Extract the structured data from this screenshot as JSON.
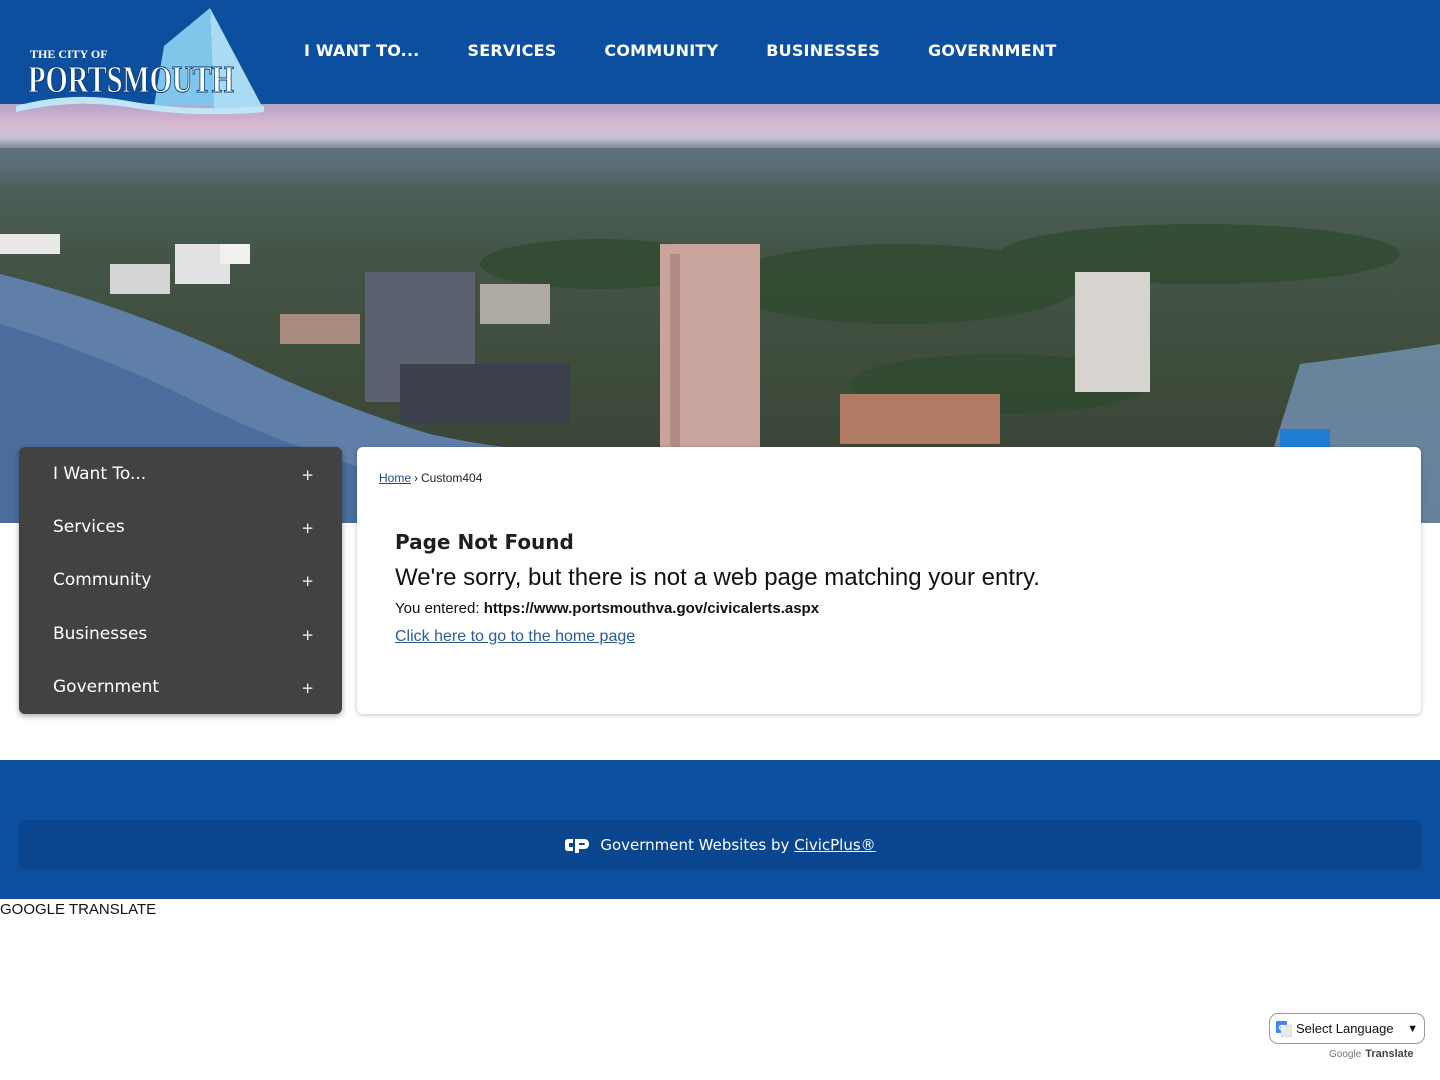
{
  "header": {
    "logo": {
      "line1": "THE CITY OF",
      "line2": "PORTSMOUTH"
    },
    "nav": [
      {
        "label": "I WANT TO..."
      },
      {
        "label": "SERVICES"
      },
      {
        "label": "COMMUNITY"
      },
      {
        "label": "BUSINESSES"
      },
      {
        "label": "GOVERNMENT"
      }
    ]
  },
  "sidebar": {
    "items": [
      {
        "label": "I Want To...",
        "expand": "+"
      },
      {
        "label": "Services",
        "expand": "+"
      },
      {
        "label": "Community",
        "expand": "+"
      },
      {
        "label": "Businesses",
        "expand": "+"
      },
      {
        "label": "Government",
        "expand": "+"
      }
    ]
  },
  "breadcrumb": {
    "home": "Home",
    "separator": "›",
    "current": "Custom404"
  },
  "content": {
    "title": "Page Not Found",
    "message": "We're sorry, but there is not a web page matching your entry.",
    "entered_label": "You entered: ",
    "entered_url": "https://www.portsmouthva.gov/civicalerts.aspx",
    "home_link": "Click here to go to the home page"
  },
  "footer": {
    "credit_text": "Government Websites by ",
    "credit_link": "CivicPlus®",
    "icon": "civicplus-logo-icon"
  },
  "google_translate": {
    "label": "GOOGLE TRANSLATE",
    "select_label": "Select Language",
    "powered_google": "Google",
    "powered_translate": "Translate"
  },
  "colors": {
    "brand_blue": "#0c4f9f",
    "sidebar_bg": "#424242",
    "link": "#2a5c93"
  }
}
